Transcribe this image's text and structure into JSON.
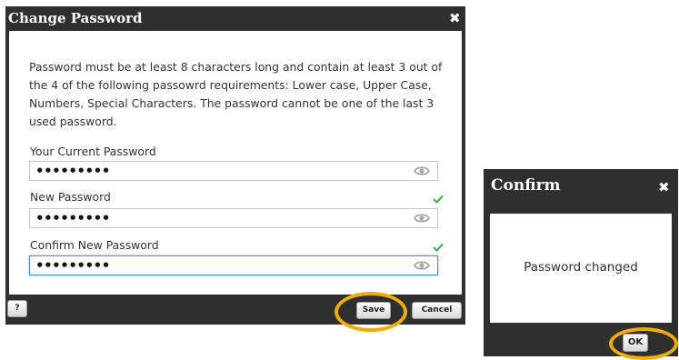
{
  "change_password_dialog": {
    "title": "Change Password",
    "close_glyph": "✖",
    "description": "Password must be at least 8 characters long and contain at least 3 out of the 4 of the following passowrd requirements: Lower case, Upper Case, Numbers, Special Characters. The password cannot be one of the last 3 used password.",
    "fields": [
      {
        "label": "Your Current Password",
        "value": "•••••••••",
        "valid": false,
        "focused": false
      },
      {
        "label": "New Password",
        "value": "•••••••••",
        "valid": true,
        "focused": false
      },
      {
        "label": "Confirm New Password",
        "value": "•••••••••",
        "valid": true,
        "focused": true
      }
    ],
    "help_label": "?",
    "save_label": "Save",
    "cancel_label": "Cancel",
    "highlighted_button": "save"
  },
  "confirm_dialog": {
    "title": "Confirm",
    "close_glyph": "✖",
    "message": "Password changed",
    "ok_label": "OK",
    "highlighted_button": "ok"
  },
  "colors": {
    "dialog_bg": "#2f2f2f",
    "highlight_ring": "#f0ac0f",
    "valid_check": "#4caf50",
    "focus_border": "#4a90d9"
  },
  "icons": [
    "close-icon",
    "eye-icon",
    "checkmark-icon",
    "help-icon"
  ]
}
